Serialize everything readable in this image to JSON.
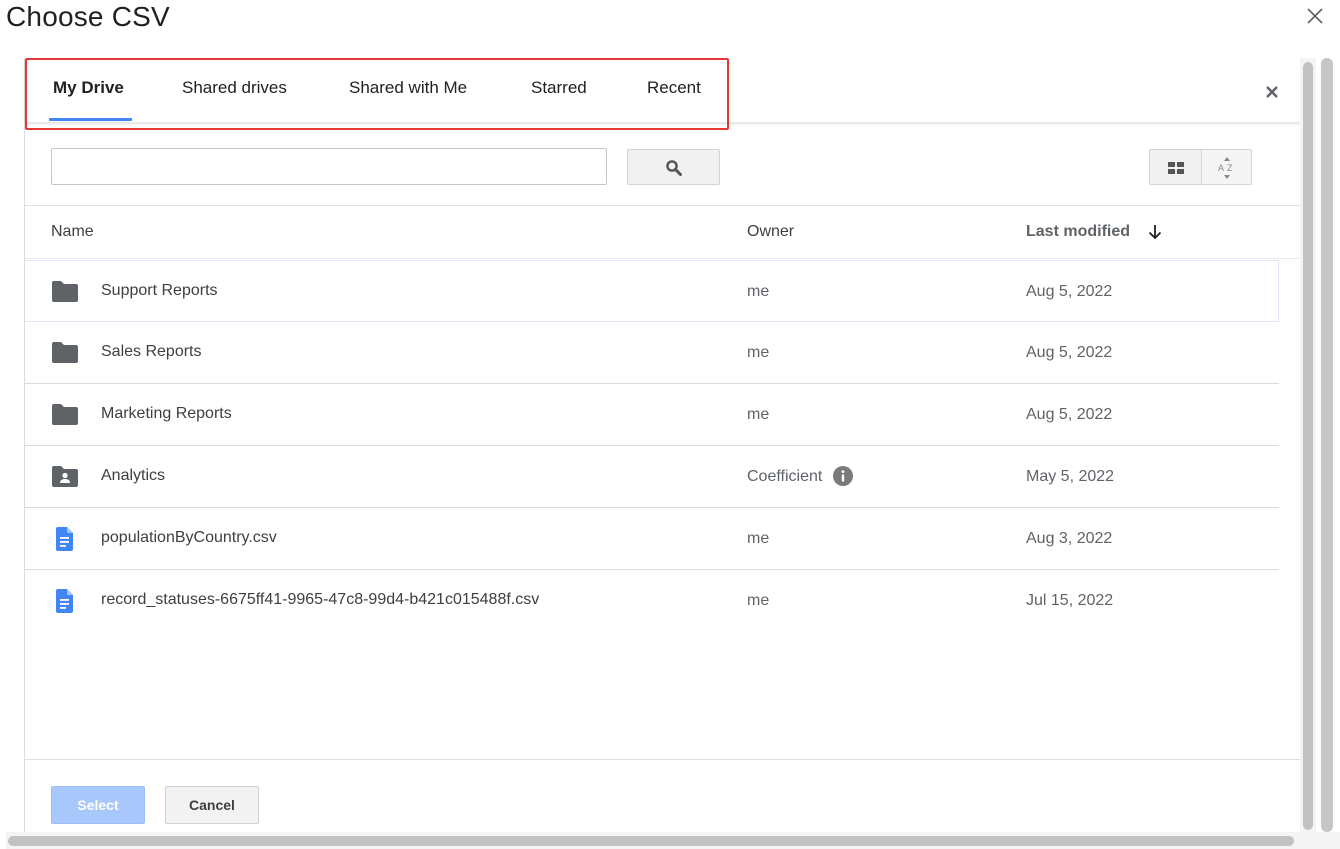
{
  "window": {
    "title": "Choose CSV",
    "close_icon": "close-icon"
  },
  "picker": {
    "tabs": [
      {
        "label": "My Drive",
        "active": true
      },
      {
        "label": "Shared drives",
        "active": false
      },
      {
        "label": "Shared with Me",
        "active": false
      },
      {
        "label": "Starred",
        "active": false
      },
      {
        "label": "Recent",
        "active": false
      }
    ],
    "search": {
      "value": "",
      "placeholder": ""
    },
    "columns": {
      "name": "Name",
      "owner": "Owner",
      "modified": "Last modified",
      "sort_direction": "descending"
    },
    "rows": [
      {
        "type": "folder",
        "icon": "folder-icon",
        "name": "Support Reports",
        "owner": "me",
        "modified": "Aug 5, 2022"
      },
      {
        "type": "folder",
        "icon": "folder-icon",
        "name": "Sales Reports",
        "owner": "me",
        "modified": "Aug 5, 2022"
      },
      {
        "type": "folder",
        "icon": "folder-icon",
        "name": "Marketing Reports",
        "owner": "me",
        "modified": "Aug 5, 2022"
      },
      {
        "type": "shared-folder",
        "icon": "shared-folder-icon",
        "name": "Analytics",
        "owner": "Coefficient",
        "modified": "May 5, 2022"
      },
      {
        "type": "file",
        "icon": "document-icon",
        "name": "populationByCountry.csv",
        "owner": "me",
        "modified": "Aug 3, 2022"
      },
      {
        "type": "file",
        "icon": "document-icon",
        "name": "record_statuses-6675ff41-9965-47c8-99d4-b421c015488f.csv",
        "owner": "me",
        "modified": "Jul 15, 2022"
      }
    ],
    "buttons": {
      "select": "Select",
      "cancel": "Cancel"
    }
  },
  "colors": {
    "accent": "#4285f4",
    "select_disabled": "#a8c7fa",
    "highlight": "#e53935",
    "file_icon": "#4285f4",
    "folder_icon": "#5f6368"
  }
}
